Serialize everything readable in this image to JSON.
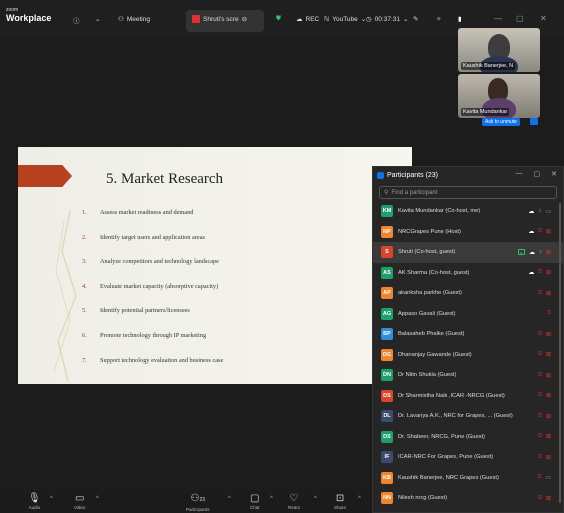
{
  "app": {
    "brand_small": "zoom",
    "brand_name": "Workplace"
  },
  "topbar": {
    "meeting_label": "Meeting",
    "share_label": "Shruti's scre",
    "rec_label": "REC",
    "youtube_label": "YouTube",
    "timer": "00:37:31"
  },
  "videos": [
    {
      "name": "Kaushik Banerjee, N"
    },
    {
      "name": "Kavita Mundankar",
      "unmute_label": "Ask to unmute"
    }
  ],
  "slide": {
    "title": "5. Market Research",
    "items": [
      {
        "num": "1.",
        "text": "Assess market readiness and demand"
      },
      {
        "num": "2.",
        "text": "Identify target users and application areas"
      },
      {
        "num": "3.",
        "text": "Analyze competitors and technology landscape"
      },
      {
        "num": "4.",
        "text": "Evaluate market capacity (absorptive capacity)"
      },
      {
        "num": "5.",
        "text": "Identify potential partners/licensees"
      },
      {
        "num": "6.",
        "text": "Promote technology through IP marketing"
      },
      {
        "num": "7.",
        "text": "Support technology evaluation and business case"
      }
    ]
  },
  "participants": {
    "title": "Participants (23)",
    "search_placeholder": "Find a participant",
    "list": [
      {
        "initials": "KM",
        "color": "#1f9e6e",
        "name": "Kavita Mundankar (Co-host, me)",
        "mic": "gray",
        "cam": "gray"
      },
      {
        "initials": "NP",
        "color": "#f0852d",
        "name": "NRCGrapes Pune (Host)",
        "mic": "off",
        "cam": "off"
      },
      {
        "initials": "S",
        "color": "#d9452b",
        "name": "Shruti (Co-host, guest)",
        "mic": "gray",
        "cam": "off",
        "share": true
      },
      {
        "initials": "AS",
        "color": "#1f9e6e",
        "name": "AK Sharma (Co-host, guest)",
        "mic": "off",
        "cam": "off"
      },
      {
        "initials": "AP",
        "color": "#f0852d",
        "name": "akanksha parkhe (Guest)",
        "mic": "off",
        "cam": "off"
      },
      {
        "initials": "AG",
        "color": "#1f9e6e",
        "name": "Appaso Gavali (Guest)",
        "mic": "off",
        "cam": ""
      },
      {
        "initials": "BP",
        "color": "#2d8fd8",
        "name": "Balasaheb Phalke (Guest)",
        "mic": "off",
        "cam": "off"
      },
      {
        "initials": "DG",
        "color": "#f0852d",
        "name": "Dhananjay Gawande (Guest)",
        "mic": "off",
        "cam": "off"
      },
      {
        "initials": "DN",
        "color": "#1f9e6e",
        "name": "Dr Nitin Shukla (Guest)",
        "mic": "off",
        "cam": "off"
      },
      {
        "initials": "DS",
        "color": "#d9452b",
        "name": "Dr Sharmistha Naik ,ICAR -NRCG (Guest)",
        "mic": "off",
        "cam": "off"
      },
      {
        "initials": "DL",
        "color": "#3a4b6e",
        "name": "Dr. Lavanya A.K., NRC for Grapes, ... (Guest)",
        "mic": "off",
        "cam": "off"
      },
      {
        "initials": "DS",
        "color": "#1f9e6e",
        "name": "Dr. Shabeer, NRCG, Pune (Guest)",
        "mic": "off",
        "cam": "off"
      },
      {
        "initials": "IF",
        "color": "#3a4b6e",
        "name": "ICAR-NRC For Grapes, Pune (Guest)",
        "mic": "off",
        "cam": "off"
      },
      {
        "initials": "KB",
        "color": "#f0852d",
        "name": "Kaushik Banerjee, NRC Grapes (Guest)",
        "mic": "off",
        "cam": "gray"
      },
      {
        "initials": "NN",
        "color": "#f0852d",
        "name": "Nilesh nrcg (Guest)",
        "mic": "off",
        "cam": "off"
      },
      {
        "initials": "",
        "color": "#1f9e6e",
        "name": "",
        "mic": "",
        "cam": ""
      }
    ]
  },
  "toolbar": {
    "audio": "Audio",
    "video": "Video",
    "participants": "Participants",
    "participants_count": "23",
    "chat": "Chat",
    "react": "React",
    "share": "Share"
  }
}
